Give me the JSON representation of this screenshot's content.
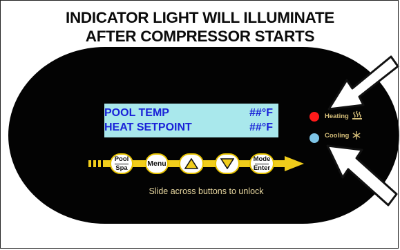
{
  "headline": {
    "line1": "INDICATOR LIGHT WILL ILLUMINATE",
    "line2": "AFTER COMPRESSOR STARTS"
  },
  "display": {
    "rows": [
      {
        "label": "POOL TEMP",
        "value": "##°F"
      },
      {
        "label": "HEAT SETPOINT",
        "value": "##°F"
      }
    ]
  },
  "indicators": {
    "heating": {
      "label": "Heating",
      "color": "#ff1a1a",
      "icon": "heat-waves-icon"
    },
    "cooling": {
      "label": "Cooling",
      "color": "#7ec4e6",
      "icon": "snowflake-icon"
    }
  },
  "buttons": {
    "pool_spa": {
      "top": "Pool",
      "bottom": "Spa"
    },
    "menu": "Menu",
    "up": "up-triangle-icon",
    "down": "down-triangle-icon",
    "mode_enter": {
      "top": "Mode",
      "bottom": "Enter"
    }
  },
  "hint": "Slide across buttons to unlock",
  "colors": {
    "panel": "#030303",
    "lcd_background": "#a9e8ec",
    "lcd_text": "#1a22d8",
    "track": "#f1cd1b",
    "hint_text": "#e9d8a0",
    "indicator_label": "#d6bf7a"
  }
}
